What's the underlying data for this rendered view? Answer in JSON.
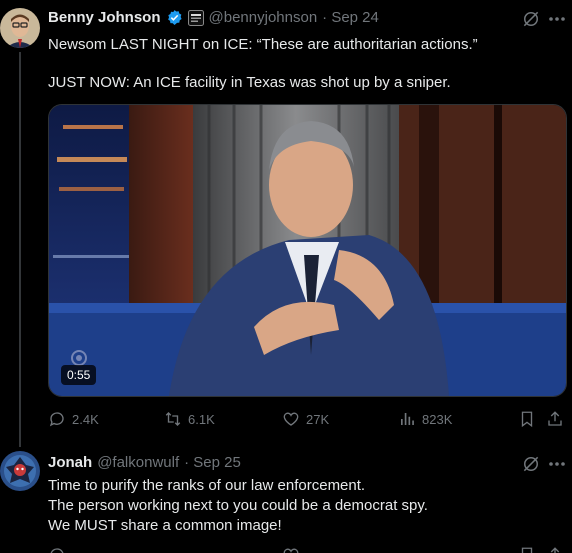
{
  "post1": {
    "author_name": "Benny Johnson",
    "handle": "@bennyjohnson",
    "date": "· Sep 24",
    "text_line1": "Newsom LAST NIGHT on ICE: “These are authoritarian actions.”",
    "text_line2": "JUST NOW: An ICE facility in Texas was shot up by a sniper.",
    "video_duration": "0:55",
    "actions": {
      "replies": "2.4K",
      "reposts": "6.1K",
      "likes": "27K",
      "views": "823K"
    }
  },
  "post2": {
    "author_name": "Jonah",
    "handle": "@falkonwulf",
    "date": "· Sep 25",
    "lines": [
      "Time to purify the ranks of our law enforcement.",
      "The person working next to you could be a democrat spy.",
      "We MUST share a common image!"
    ]
  },
  "colors": {
    "background": "#000000",
    "text_primary": "#e7e9ea",
    "text_secondary": "#71767b",
    "verified": "#1d9bf0"
  }
}
